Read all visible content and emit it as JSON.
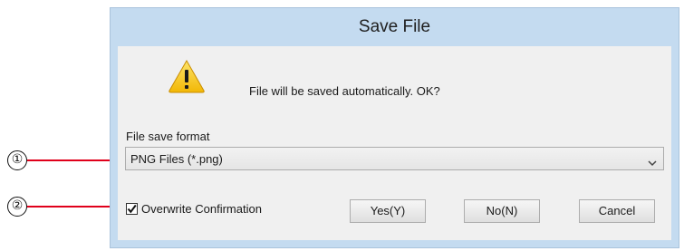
{
  "dialog": {
    "title": "Save File",
    "icon": "warning-icon",
    "message": "File will be saved automatically. OK?",
    "format_label": "File save format",
    "format_value": "PNG Files (*.png)",
    "overwrite_label": "Overwrite Confirmation",
    "overwrite_checked": true,
    "buttons": {
      "yes": "Yes(Y)",
      "no": "No(N)",
      "cancel": "Cancel"
    }
  },
  "callouts": [
    "①",
    "②"
  ],
  "colors": {
    "callout_line": "#e0001b",
    "title_bar": "#c4dbf0",
    "client": "#f0f0f0"
  }
}
